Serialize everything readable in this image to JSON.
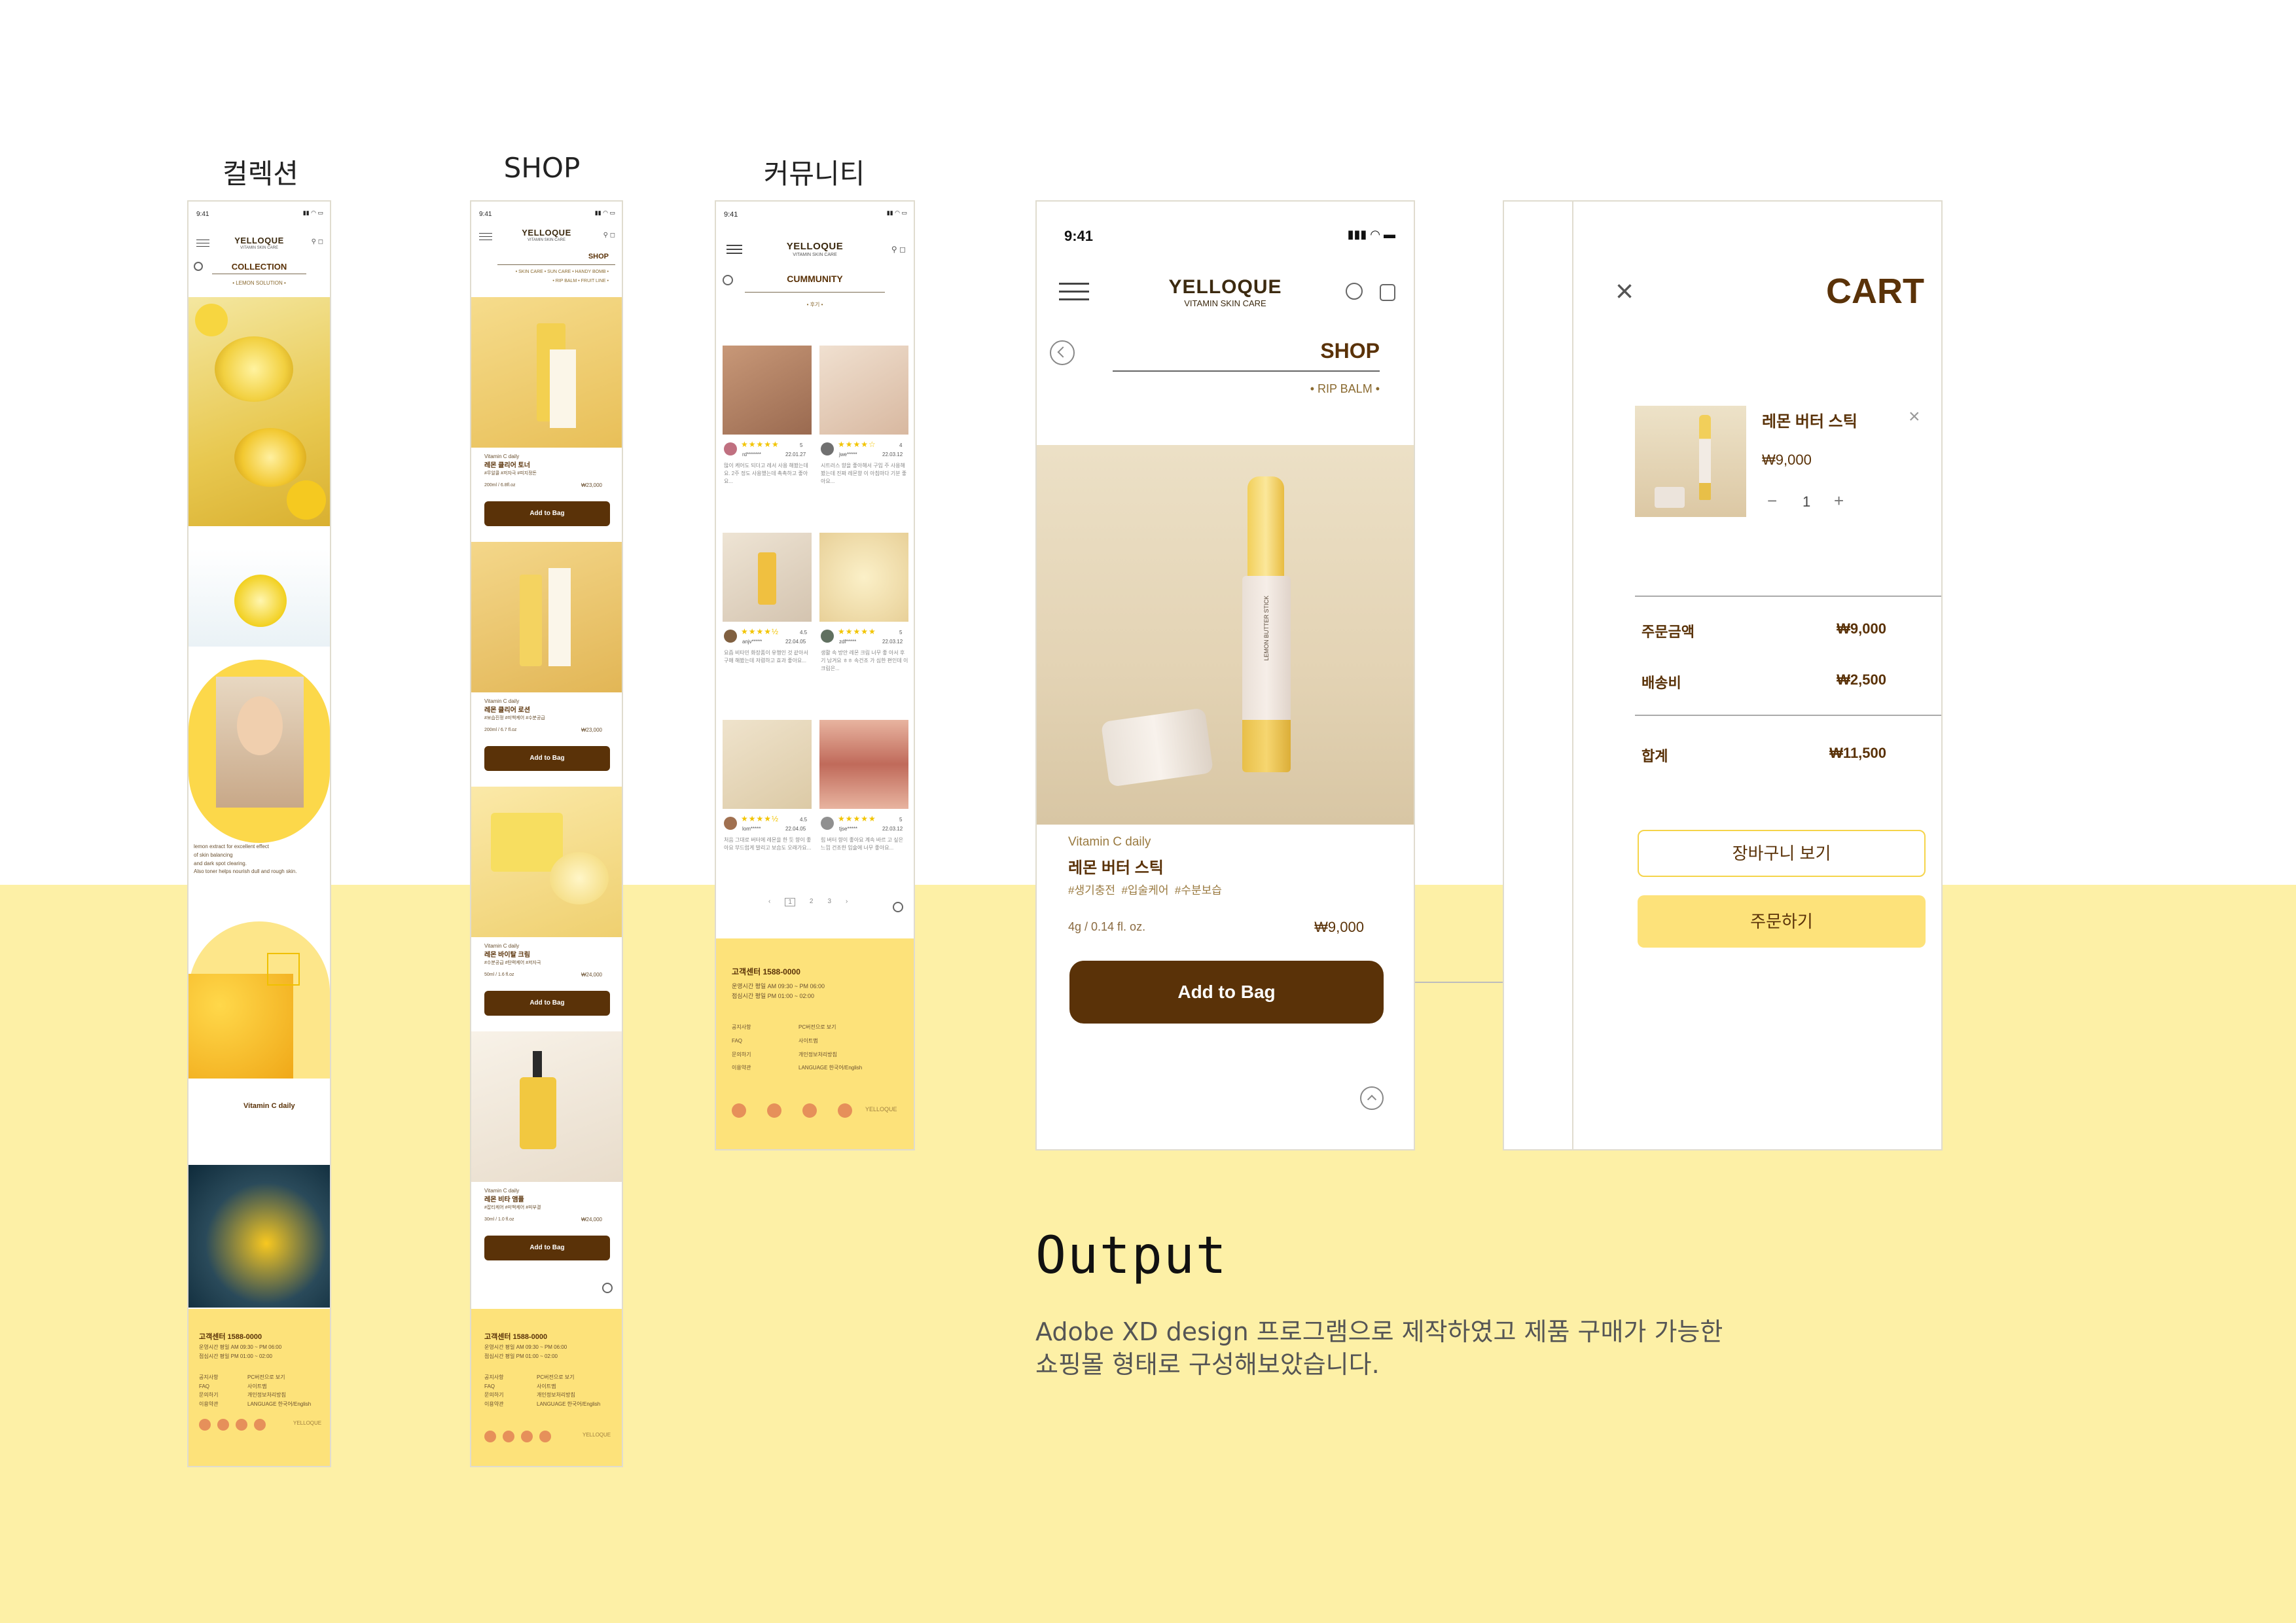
{
  "columns": {
    "collection": "컬렉션",
    "shop": "SHOP",
    "community": "커뮤니티"
  },
  "brand": {
    "logo": "YELLOQUE",
    "tagline": "VITAMIN SKIN CARE"
  },
  "status_time": "9:41",
  "collection_screen": {
    "title": "COLLECTION",
    "subtitle": "• LEMON SOLUTION •",
    "copy": [
      "lemon extract for excellent effect",
      "of skin balancing",
      "and dark spot clearing.",
      "Also toner helps nourish dull and rough skin."
    ],
    "label": "Vitamin C daily"
  },
  "shop_screen": {
    "title": "SHOP",
    "filters": "• SKIN CARE • SUN CARE • HANDY BOMB •",
    "filters2": "• RIP BALM • FRUIT LINE •",
    "products": [
      {
        "brand": "Vitamin C daily",
        "name": "레몬 클리어 토너",
        "tags": "#무알콜 #저자극 #피지정돈",
        "size": "200ml / 6.8fl.oz",
        "price": "₩23,000",
        "button": "Add to Bag"
      },
      {
        "brand": "Vitamin C daily",
        "name": "레몬 클리어 로션",
        "tags": "#보습진정 #미백케어 #수분공급",
        "size": "200ml / 6.7 fl.oz",
        "price": "₩23,000",
        "button": "Add to Bag"
      },
      {
        "brand": "Vitamin C daily",
        "name": "레몬 바이탈 크림",
        "tags": "#수분공급 #탄력케어 #저자극",
        "size": "50ml / 1.6 fl.oz",
        "price": "₩24,000",
        "button": "Add to Bag"
      },
      {
        "brand": "Vitamin C daily",
        "name": "레몬 비타 앰플",
        "tags": "#잡티케어 #미백케어 #피부결",
        "size": "30ml / 1.0 fl.oz",
        "price": "₩24,000",
        "button": "Add to Bag"
      }
    ]
  },
  "community_screen": {
    "title": "CUMMUNITY",
    "subtitle": "• 후기 •",
    "reviews": [
      {
        "rating": "5",
        "user": "rd*******",
        "date": "22.01.27",
        "text": "많이 케어도 되더고 레서 사용 해봤는데요. 2주 정도 사용했는데 촉촉하고 좋아요..."
      },
      {
        "rating": "4",
        "user": "jwe*****",
        "date": "22.03.12",
        "text": "시트러스 향을 좋아해서 구입 주 사용해봤는데 진짜 레몬향 이 아침마다 기분 좋아요..."
      },
      {
        "rating": "4.5",
        "user": "anjv*****",
        "date": "22.04.05",
        "text": "요즘 비타민 화장품이 유행인 것 같아서 구매 해봤는데 저렴하고 효과 좋아요..."
      },
      {
        "rating": "5",
        "user": "zdf*****",
        "date": "22.03.12",
        "text": "생활 속 방안 레몬 크림 너무 좋 아서 후기 남겨요 ㅎㅎ 속건조 가 심한 편인데 이 크림은..."
      },
      {
        "rating": "4.5",
        "user": "lom*****",
        "date": "22.04.05",
        "text": "처음 그대로 버터에 레몬을 한 듯 향이 좋아요 부드럽게 발리고 보습도 오래가요..."
      },
      {
        "rating": "5",
        "user": "tjse*****",
        "date": "22.03.12",
        "text": "립 버터 향이 좋아요 계속 바르 고 싶은 느낌 건조한 입술에 너무 좋아요..."
      }
    ],
    "pages": [
      "‹",
      "1",
      "2",
      "3",
      "›"
    ]
  },
  "footer": {
    "cs": "고객센터 1588-0000",
    "hours": "운영시간 평일 AM 09:30 ~ PM 06:00",
    "lunch": "점심시간 평일 PM 01:00 ~ 02:00",
    "links_left": [
      "공지사항",
      "FAQ",
      "문의하기",
      "이용약관"
    ],
    "links_right": [
      "PC버전으로 보기",
      "사이트맵",
      "개인정보처리방침",
      "LANGUAGE 한국어/English"
    ]
  },
  "detail_screen": {
    "time": "9:41",
    "page_title": "SHOP",
    "category": "• RIP BALM •",
    "brand_line": "Vitamin C daily",
    "product_name": "레몬 버터 스틱",
    "tags": "#생기충전  #입술케어  #수분보습",
    "size": "4g / 0.14 fl. oz.",
    "price": "₩9,000",
    "add_button": "Add to Bag",
    "stick_label": "LEMON BUTTER STICK"
  },
  "cart_screen": {
    "title": "CART",
    "item_name": "레몬 버터 스틱",
    "item_price": "₩9,000",
    "minus": "−",
    "qty": "1",
    "plus": "+",
    "order_label": "주문금액",
    "order_value": "₩9,000",
    "ship_label": "배송비",
    "ship_value": "₩2,500",
    "total_label": "합계",
    "total_value": "₩11,500",
    "view_cart_button": "장바구니 보기",
    "checkout_button": "주문하기"
  },
  "output": {
    "heading": "Output",
    "line1": "Adobe XD design 프로그램으로 제작하였고 제품 구매가 가능한",
    "line2": "쇼핑몰 형태로 구성해보았습니다."
  },
  "colors": {
    "brown": "#5a3208",
    "yellow": "#fde27a",
    "band": "#fdf0a6"
  }
}
